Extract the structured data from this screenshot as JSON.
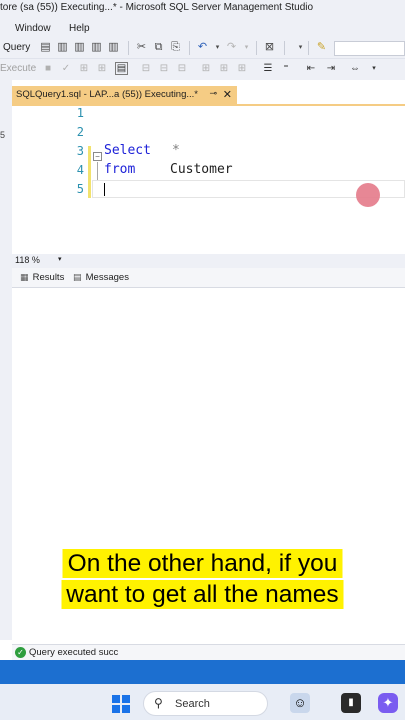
{
  "window": {
    "title": "tore (sa (55)) Executing...* - Microsoft SQL Server Management Studio"
  },
  "menu": {
    "items": [
      "Window",
      "Help"
    ]
  },
  "toolbar": {
    "query_label": "Query",
    "execute_label": "Execute"
  },
  "left_panel": {
    "partial_number": "5"
  },
  "tab": {
    "title": "SQLQuery1.sql - LAP...a (55)) Executing...*",
    "pin_icon": "pin-icon",
    "close_icon": "close-icon",
    "accent_color": "#f5cc84"
  },
  "editor": {
    "line_numbers": [
      "1",
      "2",
      "3",
      "4",
      "5"
    ],
    "lines": {
      "line3_keyword": "Select",
      "line3_operator": "*",
      "line4_keyword": "from",
      "line4_identifier": "Customer"
    },
    "keyword_color": "#1e22d8",
    "line_number_color": "#2b91af"
  },
  "zoom": {
    "level": "118 %"
  },
  "results_tabs": [
    {
      "label": "Results",
      "icon": "grid-icon"
    },
    {
      "label": "Messages",
      "icon": "messages-icon"
    }
  ],
  "status": {
    "message": "Query executed succ",
    "status_color": "#2e9e3e"
  },
  "appbar": {
    "color": "#1c6fd0"
  },
  "taskbar": {
    "search_label": "Search",
    "icons": [
      "windows-start-icon",
      "avatar-icon",
      "terminal-icon",
      "copilot-icon"
    ]
  },
  "caption": {
    "text": "On the other hand, if you want to get all the names"
  }
}
